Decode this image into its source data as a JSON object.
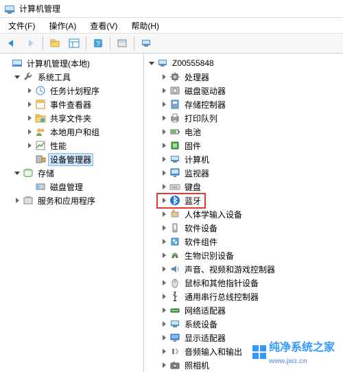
{
  "window": {
    "title": "计算机管理"
  },
  "menu": {
    "file": "文件(F)",
    "action": "操作(A)",
    "view": "查看(V)",
    "help": "帮助(H)"
  },
  "left_tree": {
    "root": "计算机管理(本地)",
    "system_tools": "系统工具",
    "task_scheduler": "任务计划程序",
    "event_viewer": "事件查看器",
    "shared_folders": "共享文件夹",
    "local_users": "本地用户和组",
    "performance": "性能",
    "device_manager": "设备管理器",
    "storage": "存储",
    "disk_management": "磁盘管理",
    "services_apps": "服务和应用程序"
  },
  "right_tree": {
    "root": "Z00555848",
    "items": [
      "处理器",
      "磁盘驱动器",
      "存储控制器",
      "打印队列",
      "电池",
      "固件",
      "计算机",
      "监视器",
      "键盘",
      "蓝牙",
      "人体学输入设备",
      "软件设备",
      "软件组件",
      "生物识别设备",
      "声音、视频和游戏控制器",
      "鼠标和其他指针设备",
      "通用串行总线控制器",
      "网络适配器",
      "系统设备",
      "显示适配器",
      "音频输入和输出",
      "照相机"
    ]
  },
  "watermark": {
    "text": "纯净系统之家",
    "url": "www.jwz.cn"
  }
}
